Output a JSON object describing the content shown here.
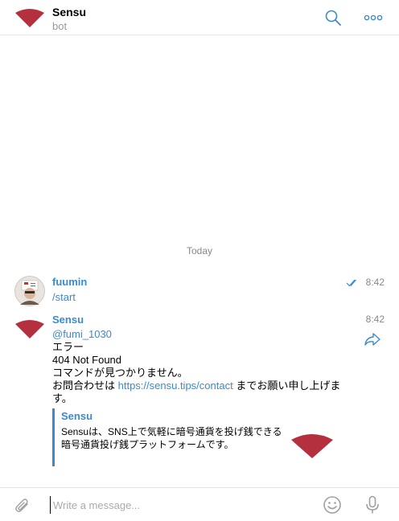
{
  "header": {
    "title": "Sensu",
    "subtitle": "bot"
  },
  "chat": {
    "date_separator": "Today",
    "messages": [
      {
        "sender": "fuumin",
        "time": "8:42",
        "lines": [
          "/start"
        ]
      },
      {
        "sender": "Sensu",
        "time": "8:42",
        "mention": "@fumi_1030",
        "lines": [
          "エラー",
          "404 Not Found",
          "コマンドが見つかりません。"
        ],
        "contact_prefix": "お問合わせは ",
        "contact_link": "https://sensu.tips/contact",
        "contact_suffix": " までお願い申し上げま",
        "contact_wrap": "す。",
        "quote": {
          "title": "Sensu",
          "lines": [
            "Sensuは、SNS上で気軽に暗号通貨を投げ銭できる",
            "暗号通貨投げ銭プラットフォームです。"
          ]
        }
      }
    ]
  },
  "composer": {
    "placeholder": "Write a message..."
  },
  "colors": {
    "accent": "#3a8ad1",
    "brand_fan": "#b5303f"
  }
}
